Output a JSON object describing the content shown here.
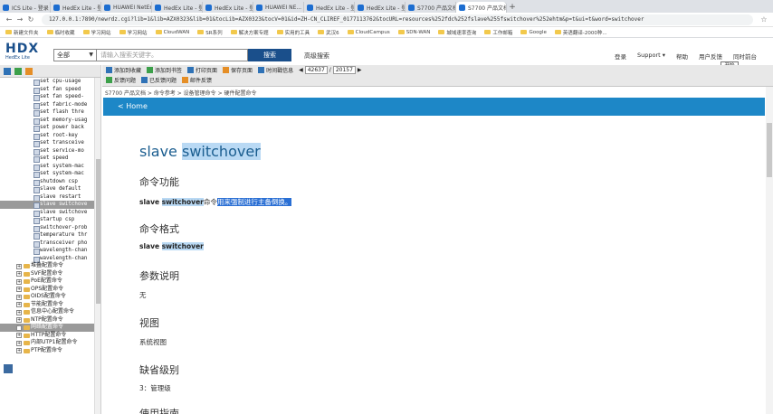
{
  "browser": {
    "tabs": [
      {
        "title": "ICS Lite - 登录",
        "active": false
      },
      {
        "title": "HedEx Lite - 登录",
        "active": false
      },
      {
        "title": "HUAWEI NetEngine...",
        "active": false
      },
      {
        "title": "HedEx Lite - 登录",
        "active": false
      },
      {
        "title": "HedEx Lite - 登录",
        "active": false
      },
      {
        "title": "HUAWEI NE...",
        "active": false
      },
      {
        "title": "HedEx Lite - 登录",
        "active": false
      },
      {
        "title": "HedEx Lite - 登录",
        "active": false
      },
      {
        "title": "S7700 产品文档 V20...",
        "active": false
      },
      {
        "title": "S7700 产品文档 V20...",
        "active": true
      }
    ],
    "url": "127.0.0.1:7890/newrdz.cgi?lib=1&lib=AZX0323&lib=01&tocLib=AZX0323&tocV=01&id=ZH-CN_CLIREF_0177113762&tocURL=resources%252fdc%252fslave%255fswitchover%252ehtm&p=t&ui=t&word=switchover",
    "bookmarks": [
      "新建文件夹",
      "临时收藏",
      "学习网站",
      "学习网站",
      "CloudWAN",
      "SR系列",
      "解决方案专题",
      "实用的工具",
      "武汉6",
      "CloudCampus",
      "SDN-WAN",
      "城域速率查询",
      "工作邮箱",
      "Google",
      "英语翻译-2000种..."
    ]
  },
  "header": {
    "logo_big": "HDX",
    "logo_small": "HedEx Lite",
    "scope": "全部",
    "search_placeholder": "请输入搜索关键字。",
    "search_button": "搜索",
    "advanced": "高级搜索",
    "links": [
      "登录",
      "Support ▾",
      "帮助",
      "用户反馈",
      "同时前台"
    ],
    "tooltip": "开始"
  },
  "tree": {
    "items": [
      "set cpu-usage",
      "set fan speed",
      "set fan speed-",
      "set fabric-mode",
      "set flash thre",
      "set memory-usag",
      "set power back",
      "set root-key",
      "set transceive",
      "set service-mo",
      "set speed",
      "set system-mac",
      "set system-mac",
      "shutdown csp",
      "slave default",
      "slave restart",
      "slave switchove",
      "slave switchove",
      "startup csp",
      "switchover-prob",
      "temperature thr",
      "transceiver pho",
      "wavelength-chan",
      "wavelength-chan"
    ],
    "selected_index": 16,
    "folders": [
      "堆叠配置命令",
      "SVF配置命令",
      "PoE配置命令",
      "OPS配置命令",
      "OIDS配置命令",
      "节能配置命令",
      "信息中心配置命令",
      "NTP配置命令",
      "网络配置命令",
      "HTTP配置命令",
      "内部UTP1配置命令",
      "PTP配置命令"
    ],
    "selected_folder_index": 8
  },
  "toolbar": {
    "row1": [
      "添加到收藏",
      "添加到书签",
      "打印页面",
      "保存页面",
      "时间戳信息"
    ],
    "page_current": "42637",
    "page_total": "20157",
    "row2": [
      "反馈问题",
      "已反馈问题",
      "邮件反馈"
    ]
  },
  "breadcrumb": "S7700 产品文档 > 命令参考 > 设备管理命令 > 硬件配置命令",
  "home": "< Home",
  "doc": {
    "title_plain": "slave ",
    "title_hl": "switchover",
    "sec_func": "命令功能",
    "func_cmd": "slave ",
    "func_cmd_hl": "switchover",
    "func_desc_a": "命令",
    "func_desc_b": "用来强制进行主备倒换。",
    "sec_format": "命令格式",
    "format_cmd": "slave ",
    "format_cmd_hl": "switchover",
    "sec_params": "参数说明",
    "params_body": "无",
    "sec_view": "视图",
    "view_body": "系统视图",
    "sec_level": "缺省级别",
    "level_body": "3：管理级",
    "sec_usage": "使用指南"
  }
}
